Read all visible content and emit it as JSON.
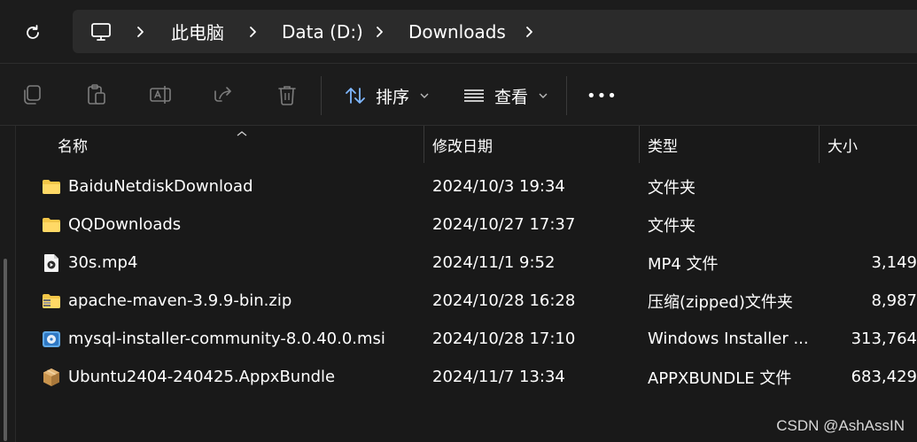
{
  "address": {
    "segments": [
      "此电脑",
      "Data (D:)",
      "Downloads"
    ]
  },
  "toolbar": {
    "sort_label": "排序",
    "view_label": "查看",
    "more_label": "•••"
  },
  "columns": {
    "name": "名称",
    "date": "修改日期",
    "type": "类型",
    "size": "大小"
  },
  "files": [
    {
      "name": "BaiduNetdiskDownload",
      "date": "2024/10/3 19:34",
      "type": "文件夹",
      "size": "",
      "icon": "folder-icon"
    },
    {
      "name": "QQDownloads",
      "date": "2024/10/27 17:37",
      "type": "文件夹",
      "size": "",
      "icon": "folder-icon"
    },
    {
      "name": "30s.mp4",
      "date": "2024/11/1 9:52",
      "type": "MP4 文件",
      "size": "3,149",
      "icon": "video-file-icon"
    },
    {
      "name": "apache-maven-3.9.9-bin.zip",
      "date": "2024/10/28 16:28",
      "type": "压缩(zipped)文件夹",
      "size": "8,987",
      "icon": "zip-folder-icon"
    },
    {
      "name": "mysql-installer-community-8.0.40.0.msi",
      "date": "2024/10/28 17:10",
      "type": "Windows Installer ...",
      "size": "313,764",
      "icon": "msi-installer-icon"
    },
    {
      "name": "Ubuntu2404-240425.AppxBundle",
      "date": "2024/11/7 13:34",
      "type": "APPXBUNDLE 文件",
      "size": "683,429",
      "icon": "appx-package-icon"
    }
  ],
  "watermark": "CSDN @AshAssIN",
  "colors": {
    "background": "#191919",
    "address_bar": "#2b2b2b",
    "folder": "#f3c648",
    "toolbar_icon": "#7d7d7d"
  }
}
